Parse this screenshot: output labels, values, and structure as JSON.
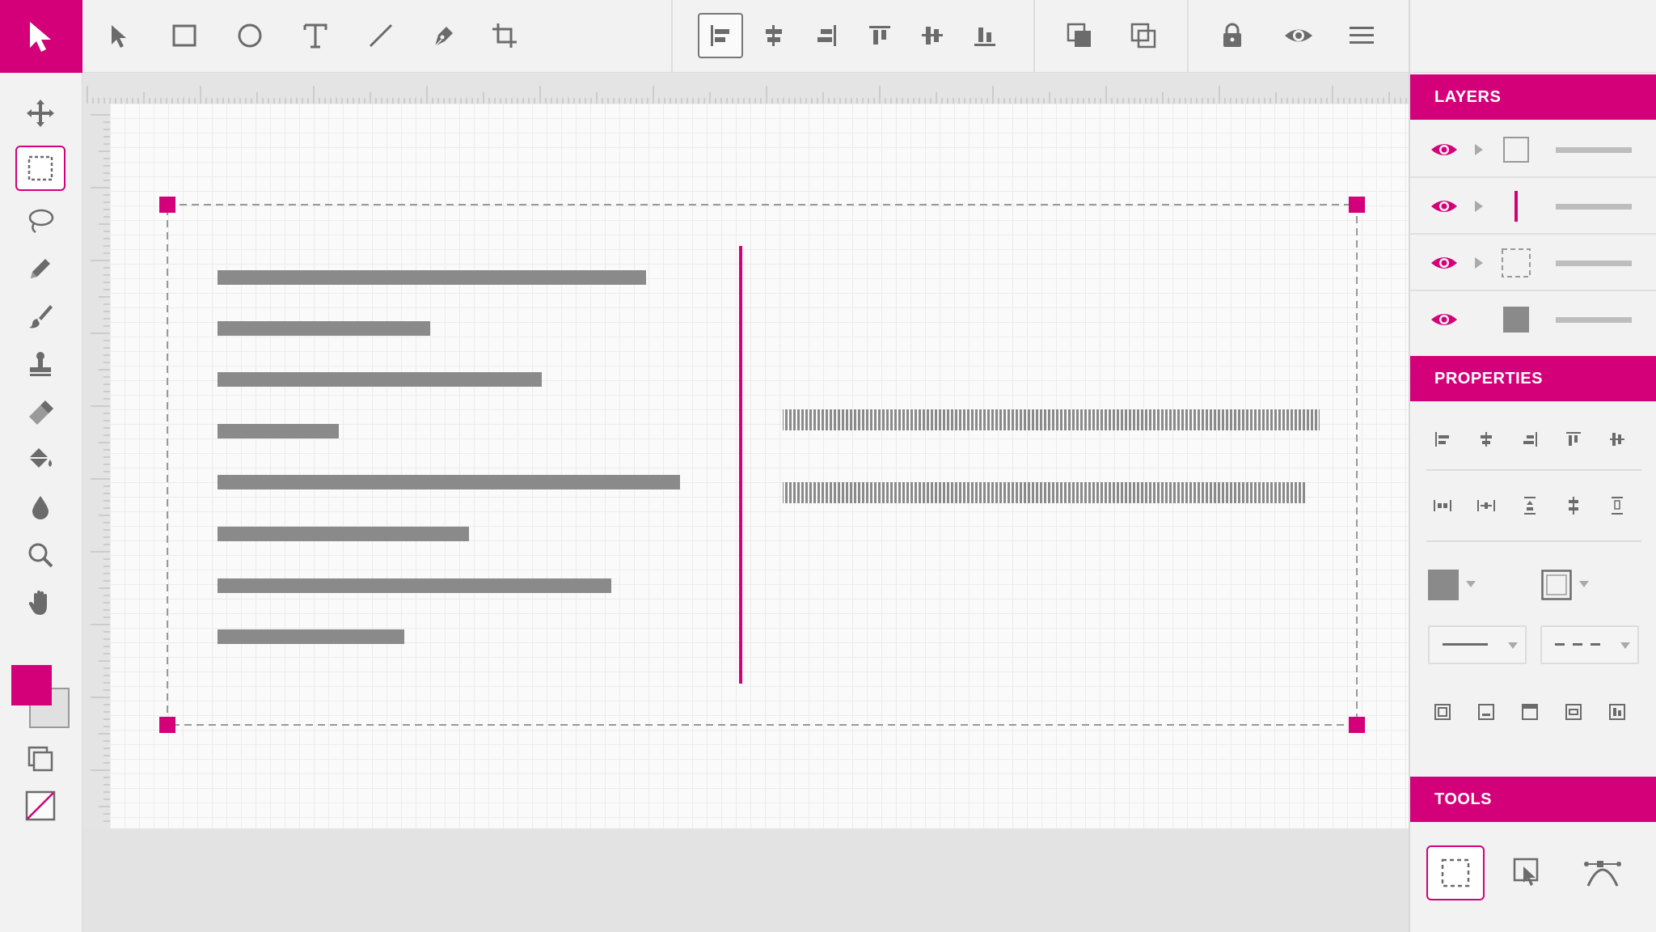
{
  "colors": {
    "accent": "#d4007a",
    "icon": "#6b6b6b",
    "text_bar": "#8a8a8a",
    "panel_bg": "#f2f2f2",
    "canvas_bg": "#fafafa"
  },
  "top_toolbar": {
    "tools": [
      "select-arrow-icon",
      "rectangle-icon",
      "ellipse-icon",
      "text-icon",
      "line-icon",
      "pen-icon",
      "crop-icon"
    ],
    "align": [
      "align-left-icon",
      "align-center-h-icon",
      "align-right-icon",
      "align-top-icon",
      "align-middle-icon",
      "align-bottom-icon"
    ],
    "arrange": [
      "bring-forward-icon",
      "send-backward-icon"
    ],
    "view": [
      "lock-icon",
      "eye-icon",
      "menu-icon"
    ]
  },
  "left_toolbar": {
    "tools": [
      "move-icon",
      "marquee-select-icon",
      "lasso-icon",
      "pencil-icon",
      "brush-icon",
      "stamp-icon",
      "eraser-icon",
      "paint-bucket-icon",
      "blur-drop-icon",
      "zoom-icon",
      "hand-icon"
    ],
    "fill_color": "#d4007a",
    "stroke_color": "#e0e0e0"
  },
  "canvas": {
    "paragraph_lines": 8,
    "selection_handles": 4
  },
  "panels": {
    "layers": {
      "title": "LAYERS",
      "rows": [
        {
          "thumb": "rectangle-outline",
          "visible": true
        },
        {
          "thumb": "vertical-line",
          "visible": true
        },
        {
          "thumb": "dashed-selection",
          "visible": true
        },
        {
          "thumb": "filled-square",
          "visible": true
        }
      ]
    },
    "properties": {
      "title": "PROPERTIES"
    },
    "tools": {
      "title": "TOOLS",
      "items": [
        "marquee-tool-icon",
        "transform-select-icon",
        "bezier-curve-icon"
      ]
    }
  }
}
